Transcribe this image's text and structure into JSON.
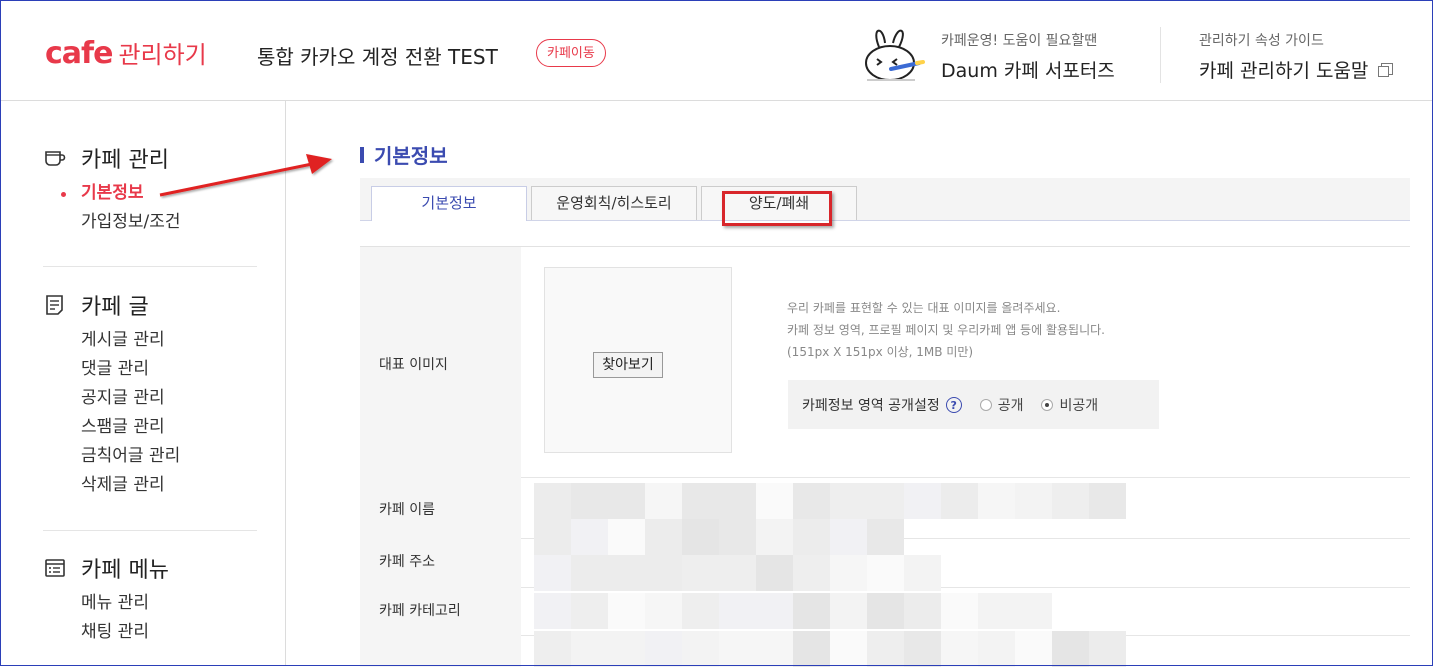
{
  "header": {
    "logo_cafe": "cafe",
    "logo_manage": "관리하기",
    "cafe_title": "통합 카카오 계정 전환 TEST",
    "move_badge": "카페이동",
    "support_sub": "카페운영! 도움이 필요할땐",
    "support_main": "Daum 카페 서포터즈",
    "guide_sub": "관리하기 속성 가이드",
    "guide_main": "카페 관리하기 도움말"
  },
  "sidebar": {
    "sections": [
      {
        "title": "카페 관리",
        "icon": "cup-icon",
        "items": [
          "기본정보",
          "가입정보/조건"
        ]
      },
      {
        "title": "카페 글",
        "icon": "document-icon",
        "items": [
          "게시글 관리",
          "댓글 관리",
          "공지글 관리",
          "스팸글 관리",
          "금칙어글 관리",
          "삭제글 관리"
        ]
      },
      {
        "title": "카페 메뉴",
        "icon": "menu-list-icon",
        "items": [
          "메뉴 관리",
          "채팅 관리"
        ]
      }
    ],
    "active_item": "기본정보"
  },
  "main": {
    "title": "기본정보",
    "tabs": [
      {
        "label": "기본정보",
        "active": true
      },
      {
        "label": "운영회칙/히스토리",
        "active": false
      },
      {
        "label": "양도/폐쇄",
        "active": false
      }
    ],
    "form": {
      "image_label": "대표 이미지",
      "find_button": "찾아보기",
      "desc_lines": [
        "우리 카페를 표현할 수 있는 대표 이미지를 올려주세요.",
        "카페 정보 영역, 프로필 페이지 및 우리카페 앱 등에 활용됩니다.",
        "(151px X 151px 이상, 1MB 미만)"
      ],
      "visibility_label": "카페정보 영역 공개설정",
      "help_glyph": "?",
      "radio_public": "공개",
      "radio_private": "비공개",
      "radio_selected": "비공개",
      "name_label": "카페 이름",
      "address_label": "카페 주소",
      "category_label": "카페 카테고리"
    }
  },
  "colors": {
    "brand": "#e8394a",
    "accent_blue": "#3b4bb0",
    "highlight_red": "#d8262b"
  }
}
